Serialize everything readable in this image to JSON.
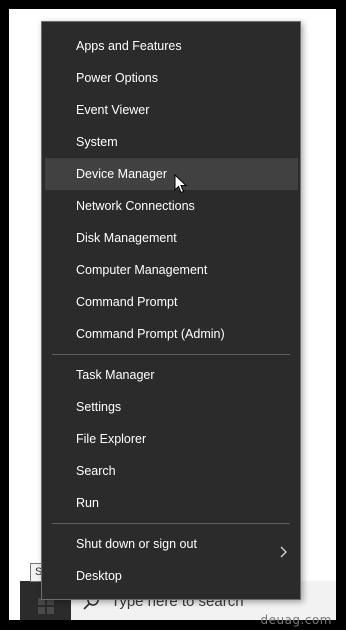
{
  "menu": {
    "group1": [
      {
        "label": "Apps and Features"
      },
      {
        "label": "Power Options"
      },
      {
        "label": "Event Viewer"
      },
      {
        "label": "System"
      },
      {
        "label": "Device Manager",
        "state": "hovered"
      },
      {
        "label": "Network Connections"
      },
      {
        "label": "Disk Management"
      },
      {
        "label": "Computer Management"
      },
      {
        "label": "Command Prompt"
      },
      {
        "label": "Command Prompt (Admin)"
      }
    ],
    "group2": [
      {
        "label": "Task Manager"
      },
      {
        "label": "Settings"
      },
      {
        "label": "File Explorer"
      },
      {
        "label": "Search"
      },
      {
        "label": "Run"
      }
    ],
    "group3": [
      {
        "label": "Shut down or sign out",
        "submenu_icon": "chevron-right-icon"
      },
      {
        "label": "Desktop"
      }
    ]
  },
  "tooltip": {
    "text": "Start"
  },
  "taskbar": {
    "start_icon": "windows-logo-icon",
    "search_icon": "search-icon",
    "search_placeholder": "Type here to search"
  },
  "watermark": {
    "text": "deuag.com"
  },
  "colors": {
    "menu_background": "#2b2b2b",
    "menu_hover": "#414141",
    "menu_text": "#ffffff",
    "separator": "#5f5f5f",
    "desktop": "#ffffff",
    "frame": "#000000"
  }
}
